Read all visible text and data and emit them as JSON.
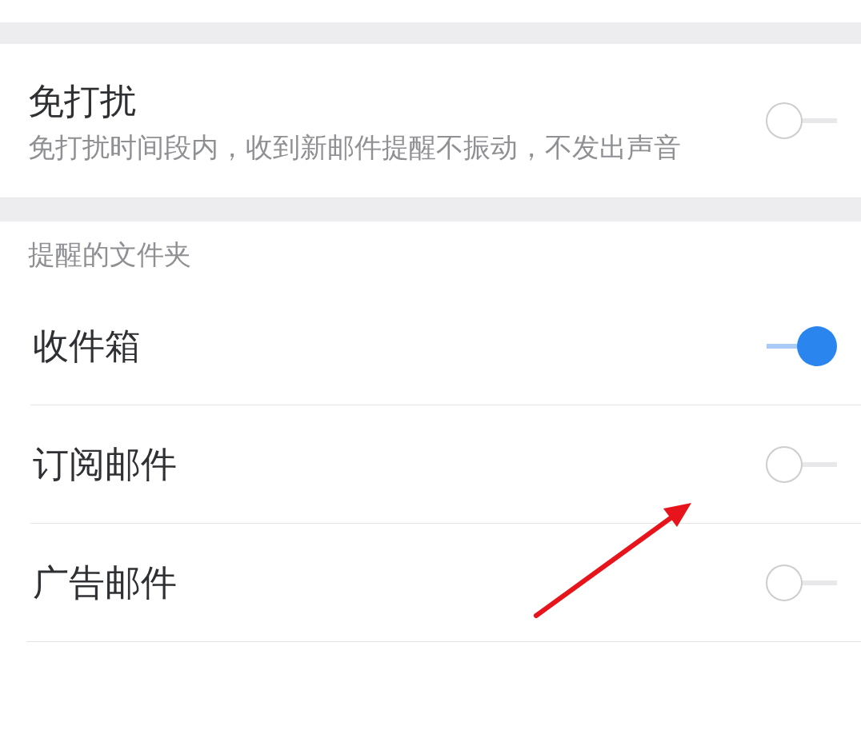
{
  "dnd": {
    "title": "免打扰",
    "description": "免打扰时间段内，收到新邮件提醒不振动，不发出声音",
    "on": false
  },
  "folders": {
    "header": "提醒的文件夹",
    "items": [
      {
        "label": "收件箱",
        "on": true
      },
      {
        "label": "订阅邮件",
        "on": false
      },
      {
        "label": "广告邮件",
        "on": false
      }
    ]
  }
}
